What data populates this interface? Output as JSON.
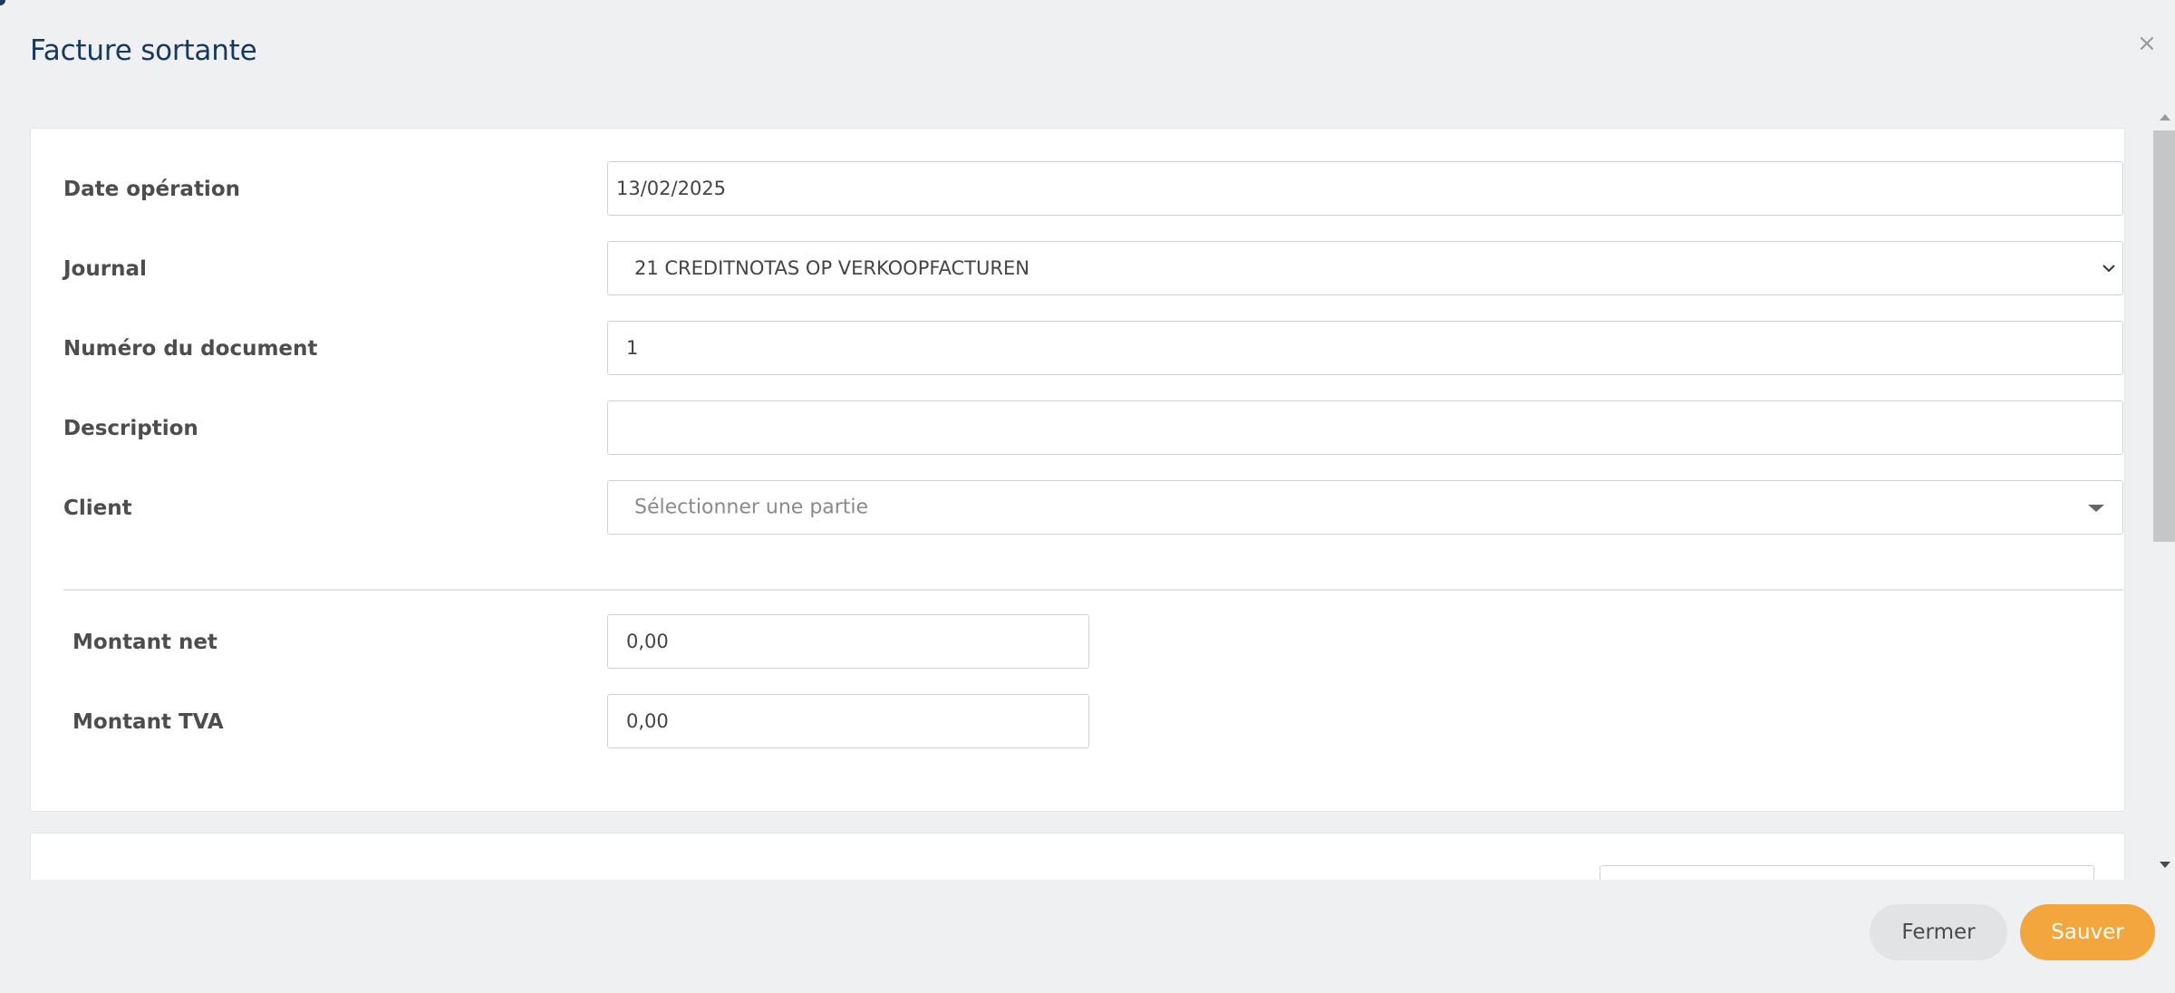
{
  "modal": {
    "title": "Facture sortante",
    "close_symbol": "×"
  },
  "form": {
    "date": {
      "label": "Date opération",
      "value": "13/02/2025"
    },
    "journal": {
      "label": "Journal",
      "value": "21 CREDITNOTAS OP VERKOOPFACTUREN"
    },
    "document_number": {
      "label": "Numéro du document",
      "value": "1"
    },
    "description": {
      "label": "Description",
      "value": ""
    },
    "client": {
      "label": "Client",
      "placeholder": "Sélectionner une partie"
    },
    "net_amount": {
      "label": "Montant net",
      "value": "0,00"
    },
    "vat_amount": {
      "label": "Montant TVA",
      "value": "0,00"
    }
  },
  "footer": {
    "close_label": "Fermer",
    "save_label": "Sauver"
  },
  "colors": {
    "title": "#17395f",
    "primary_button": "#f3a63d",
    "secondary_button": "#e2e3e5",
    "background": "#eff0f2"
  }
}
